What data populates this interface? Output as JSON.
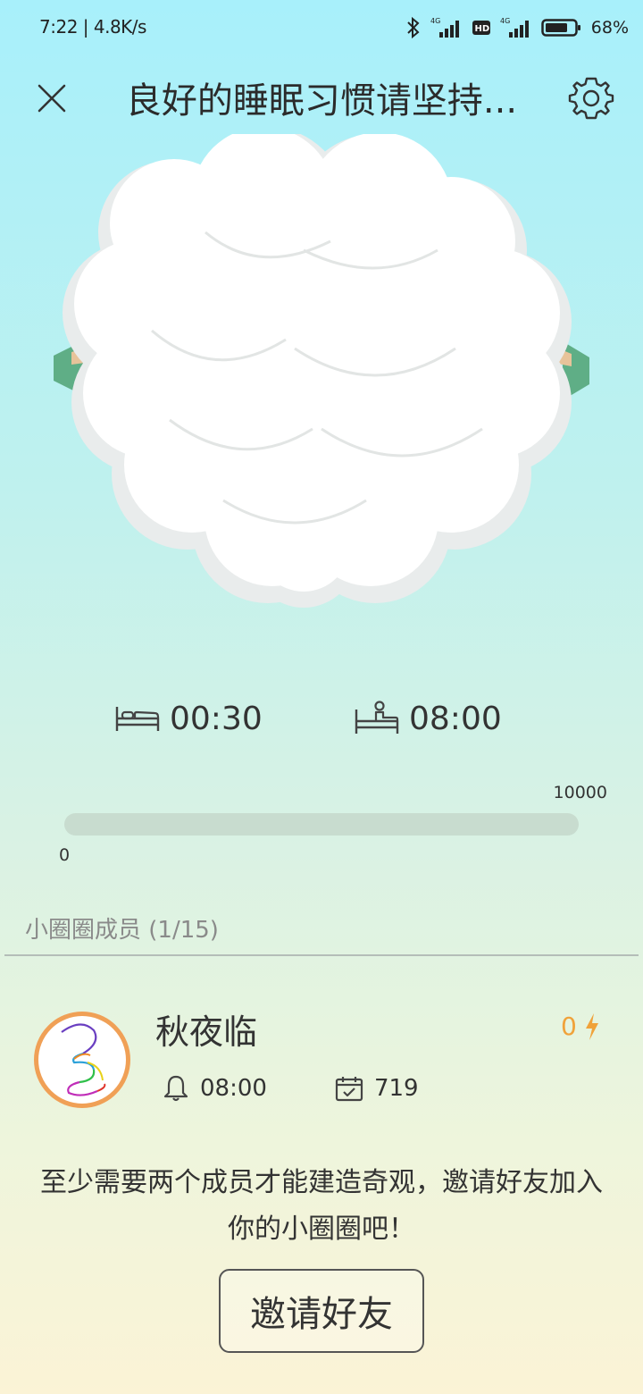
{
  "status_bar": {
    "time": "7:22 | 4.8K/s",
    "battery": "68%",
    "icons": [
      "bluetooth-icon",
      "4g-signal-icon",
      "hd-icon",
      "4g-signal-icon",
      "battery-icon"
    ]
  },
  "header": {
    "title": "良好的睡眠习惯请坚持...",
    "close_icon": "close-icon",
    "settings_icon": "gear-icon"
  },
  "sleep": {
    "bedtime": "00:30",
    "wake_time": "08:00",
    "bedtime_icon": "bed-icon",
    "wake_icon": "wake-up-bed-icon"
  },
  "progress": {
    "min_label": "0",
    "max_label": "10000",
    "value_fraction": 0
  },
  "members": {
    "title": "小圈圈成员 (1/15)",
    "list": [
      {
        "name": "秋夜临",
        "energy": "0",
        "alarm_time": "08:00",
        "check_in_days": "719"
      }
    ]
  },
  "invite": {
    "message": "至少需要两个成员才能建造奇观，邀请好友加入你的小圈圈吧！",
    "button_label": "邀请好友"
  },
  "colors": {
    "accent_orange": "#f0a056",
    "energy_orange": "#f0a23a",
    "island_green": "#5fae86"
  }
}
